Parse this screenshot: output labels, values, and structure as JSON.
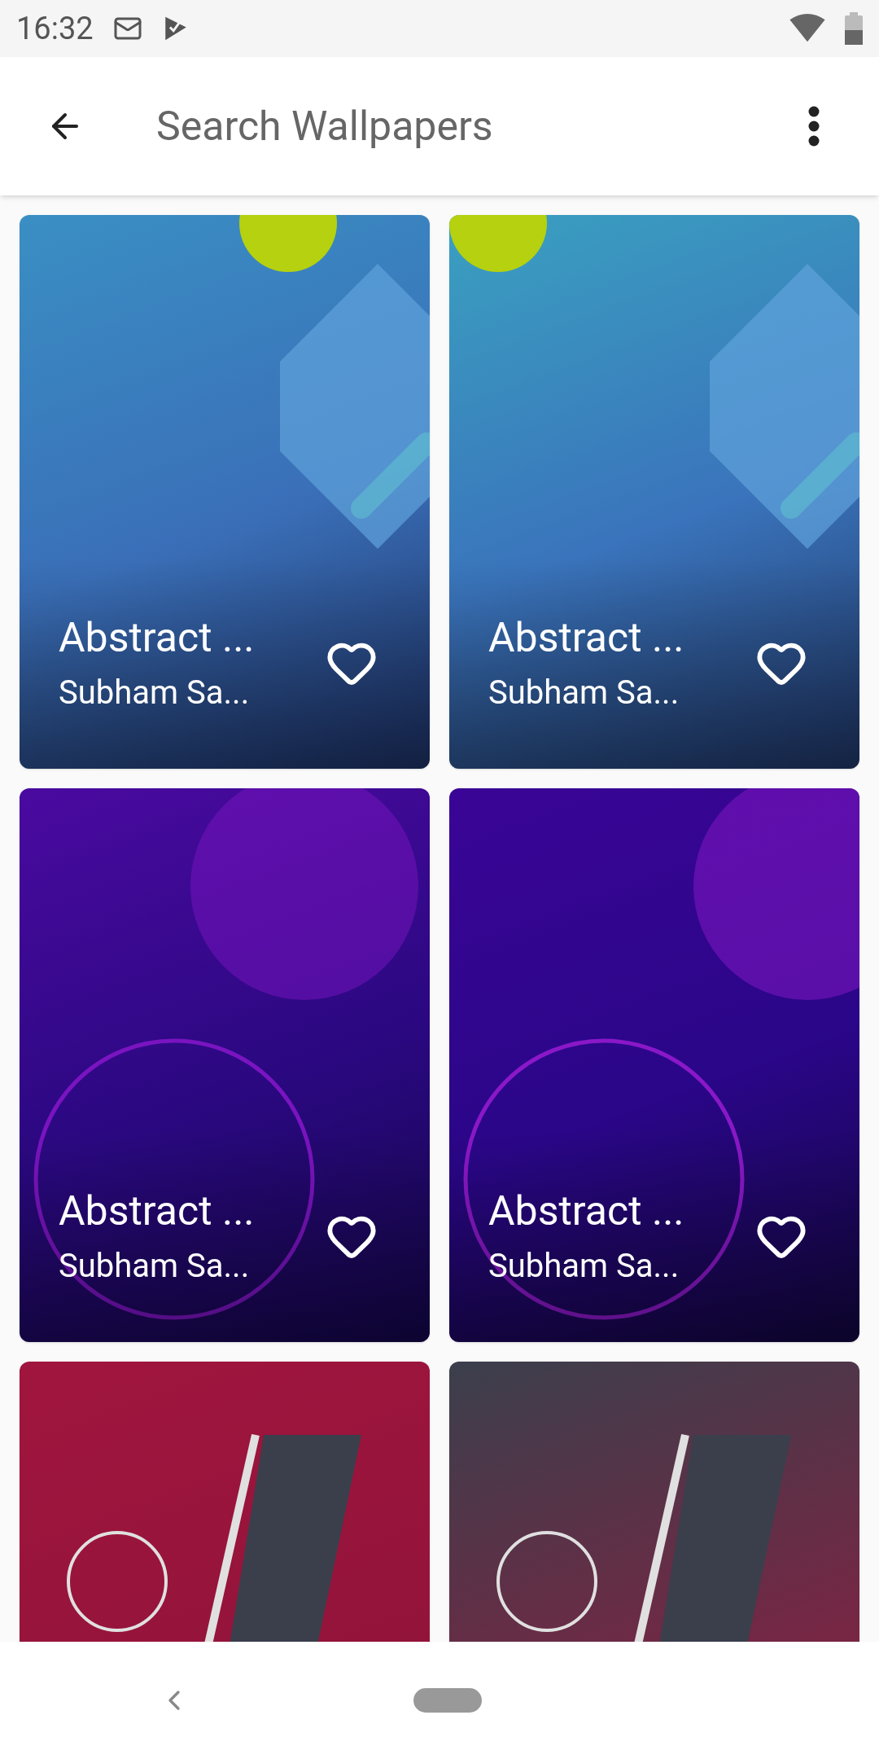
{
  "status_bar": {
    "time": "16:32"
  },
  "app_bar": {
    "search": {
      "placeholder": "Search Wallpapers"
    }
  },
  "wallpapers": [
    {
      "kind": "blue",
      "title": "Abstract ...",
      "author": "Subham Sa...",
      "favorite": false
    },
    {
      "kind": "teal",
      "title": "Abstract ...",
      "author": "Subham Sa...",
      "favorite": false
    },
    {
      "kind": "violet",
      "title": "Abstract ...",
      "author": "Subham Sa...",
      "favorite": false
    },
    {
      "kind": "indigo",
      "title": "Abstract ...",
      "author": "Subham Sa...",
      "favorite": false
    },
    {
      "kind": "crimson"
    },
    {
      "kind": "slate"
    }
  ]
}
